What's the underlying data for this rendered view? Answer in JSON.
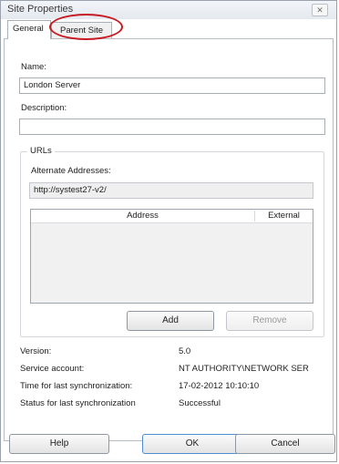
{
  "window": {
    "title": "Site Properties",
    "close_glyph": "✕"
  },
  "tabs": [
    {
      "label": "General",
      "active": true
    },
    {
      "label": "Parent Site",
      "active": false
    }
  ],
  "general": {
    "name_label": "Name:",
    "name_value": "London Server",
    "description_label": "Description:",
    "description_value": "",
    "urls_group": "URLs",
    "alternate_label": "Alternate Addresses:",
    "alternate_value": "http://systest27-v2/",
    "columns": [
      "Address",
      "External"
    ],
    "add_button": "Add",
    "remove_button": "Remove",
    "info": [
      {
        "label": "Version:",
        "value": "5.0"
      },
      {
        "label": "Service account:",
        "value": "NT AUTHORITY\\NETWORK SER"
      },
      {
        "label": "Time for last synchronization:",
        "value": "17-02-2012 10:10:10"
      },
      {
        "label": "Status for last synchronization",
        "value": "Successful"
      }
    ]
  },
  "footer": {
    "help_button": "Help",
    "ok_button": "OK",
    "cancel_button": "Cancel"
  },
  "annotation": {
    "color": "#c71a22"
  }
}
